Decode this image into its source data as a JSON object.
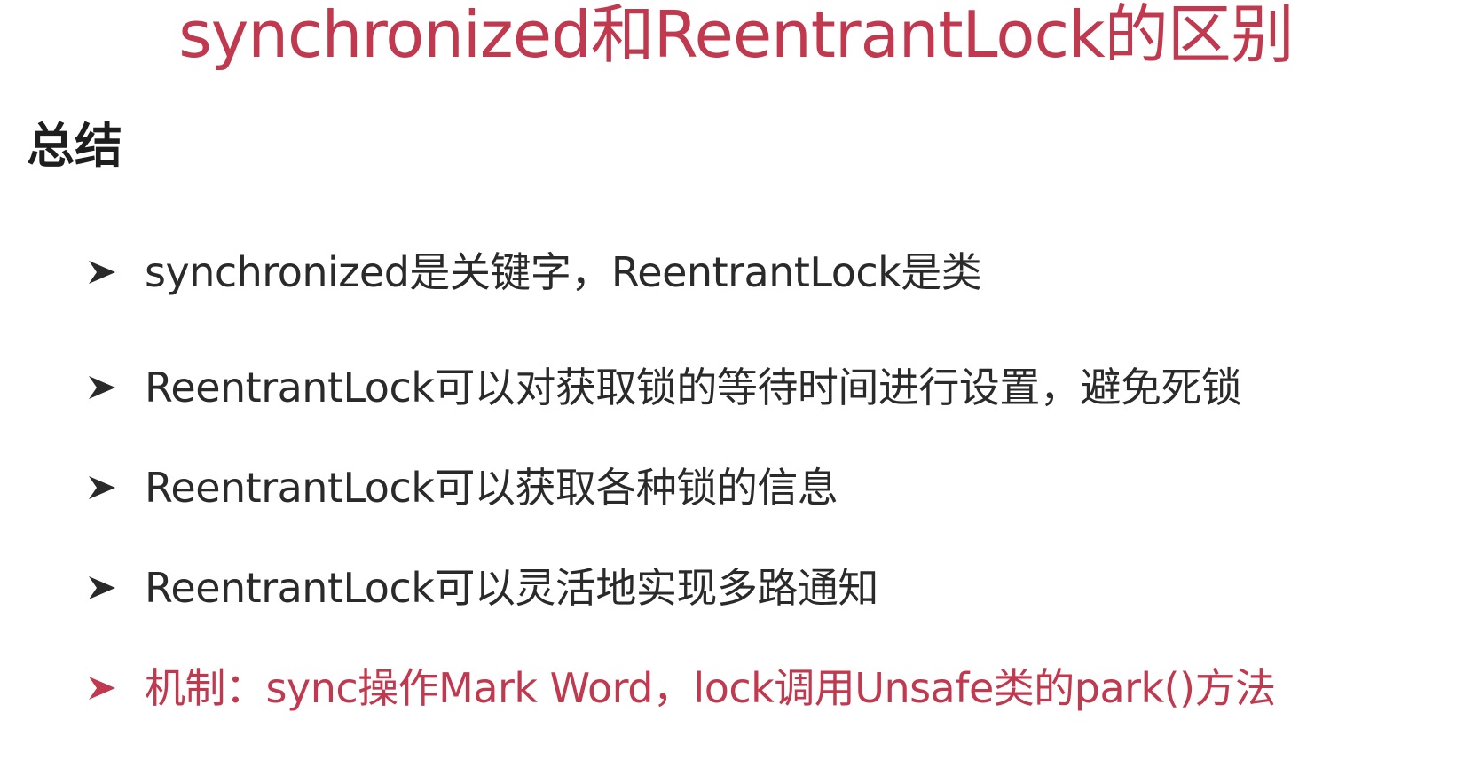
{
  "slide": {
    "title": "synchronized和ReentrantLock的区别",
    "subtitle": "总结",
    "colors": {
      "accent": "#c0394e",
      "text": "#2a2a2a",
      "heading": "#1e1e1e",
      "background": "#ffffff"
    },
    "bullet_icon": "arrowhead-bullet-icon",
    "bullets": [
      {
        "text": "synchronized是关键字，ReentrantLock是类",
        "highlight": false
      },
      {
        "text": "ReentrantLock可以对获取锁的等待时间进行设置，避免死锁",
        "highlight": false
      },
      {
        "text": "ReentrantLock可以获取各种锁的信息",
        "highlight": false
      },
      {
        "text": "ReentrantLock可以灵活地实现多路通知",
        "highlight": false
      },
      {
        "text": "机制：sync操作Mark Word，lock调用Unsafe类的park()方法",
        "highlight": true
      }
    ]
  }
}
